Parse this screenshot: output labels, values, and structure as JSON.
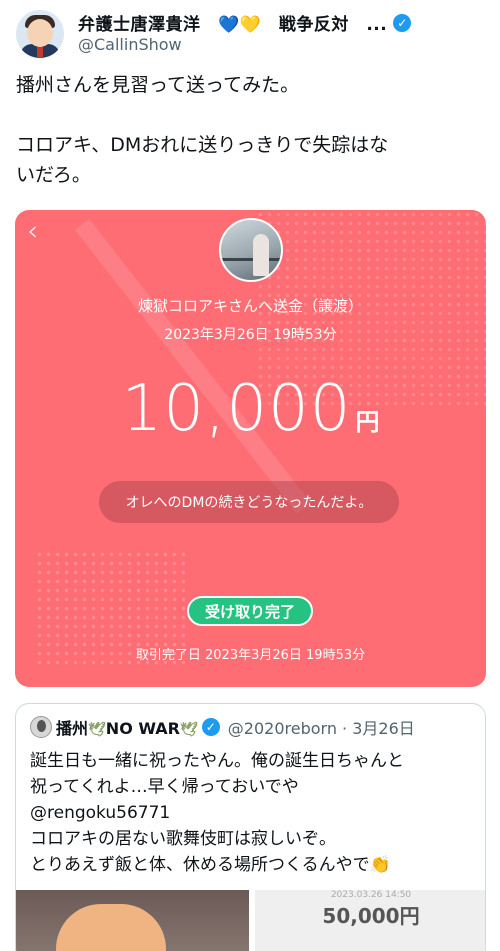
{
  "author": {
    "display_name": "弁護士唐澤貴洋　💙💛　戦争反対　...",
    "handle": "@CallinShow"
  },
  "tweet": {
    "line1": "播州さんを見習って送ってみた。",
    "line2": "コロアキ、DMおれに送りっきりで失踪はな",
    "line3": "いだろ。"
  },
  "payment": {
    "title": "煉獄コロアキさんへ送金（譲渡）",
    "date": "2023年3月26日 19時53分",
    "amount": "10,000",
    "currency": "円",
    "message": "オレへのDMの続きどうなったんだよ。",
    "status": "受け取り完了",
    "completed_at": "取引完了日 2023年3月26日 19時53分"
  },
  "quoted": {
    "name": "播州",
    "dove1": "🕊",
    "no_war": "NO WAR",
    "dove2": "🕊",
    "handle": "@2020reborn · 3月26日",
    "line1": "誕生日も一緒に祝ったやん。俺の誕生日ちゃんと",
    "line2": "祝ってくれよ…早く帰っておいでや",
    "line3": "@rengoku56771",
    "line4": "コロアキの居ない歌舞伎町は寂しいぞ。",
    "line5": "とりあえず飯と体、休める場所つくるんやで👏",
    "media_date": "2023.03.26 14:50",
    "media_amount": "50,000円"
  },
  "icons": {
    "verified": "verified-badge-icon",
    "back": "chevron-left-icon"
  },
  "colors": {
    "card": "#fd6d73",
    "badge": "#26c281",
    "verified": "#1d9bf0"
  }
}
